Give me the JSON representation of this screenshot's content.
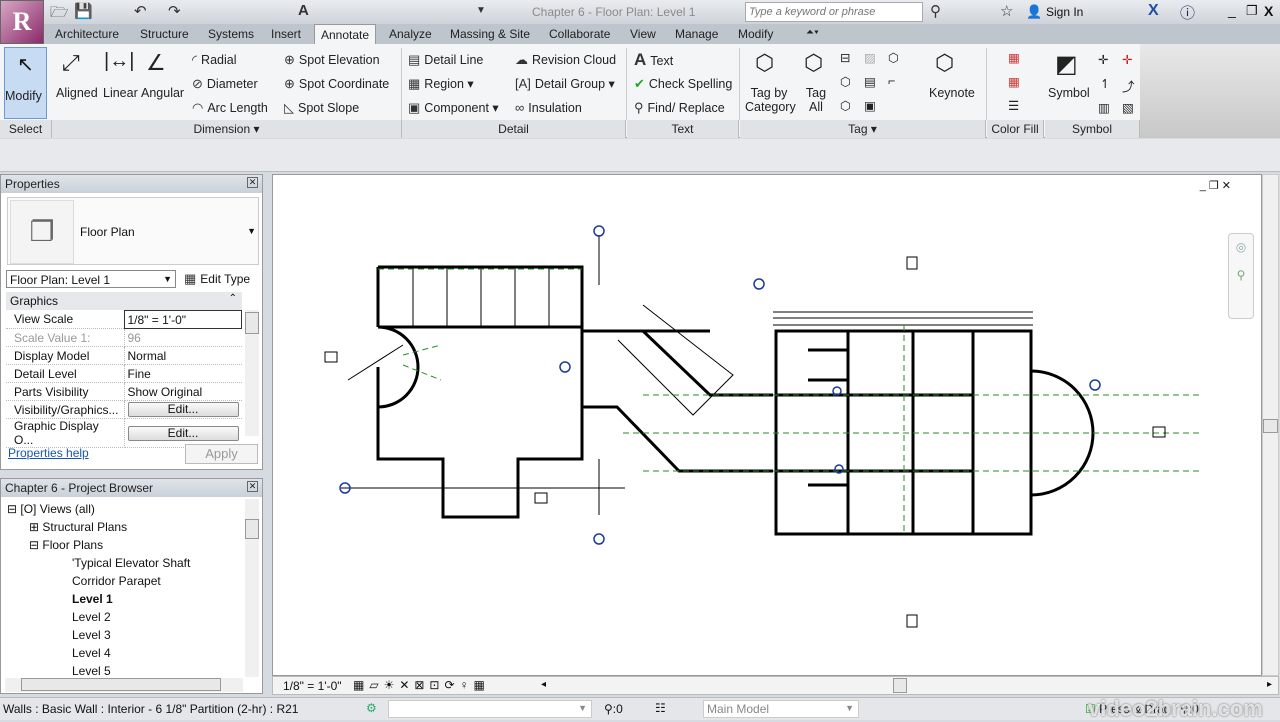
{
  "app": {
    "logo": "R",
    "title": "Chapter 6 - Floor Plan: Level 1",
    "search_placeholder": "Type a keyword or phrase",
    "sign_in": "Sign In"
  },
  "tabs": [
    "Architecture",
    "Structure",
    "Systems",
    "Insert",
    "Annotate",
    "Analyze",
    "Massing & Site",
    "Collaborate",
    "View",
    "Manage",
    "Modify"
  ],
  "ribbon": {
    "select": {
      "modify": "Modify",
      "label": "Select"
    },
    "dimension": {
      "aligned": "Aligned",
      "linear": "Linear",
      "angular": "Angular",
      "radial": "Radial",
      "diameter": "Diameter",
      "arc_length": "Arc  Length",
      "spot_elevation": "Spot  Elevation",
      "spot_coordinate": "Spot  Coordinate",
      "spot_slope": "Spot  Slope",
      "label": "Dimension ▾"
    },
    "detail": {
      "detail_line": "Detail  Line",
      "region": "Region  ▾",
      "component": "Component  ▾",
      "revision_cloud": "Revision  Cloud",
      "detail_group": "Detail  Group  ▾",
      "insulation": "Insulation",
      "label": "Detail"
    },
    "text": {
      "text": "Text",
      "check_spelling": "Check Spelling",
      "find_replace": "Find/  Replace",
      "label": "Text"
    },
    "tag": {
      "tag_by_category": "Tag by Category",
      "tag_all": "Tag All",
      "keynote": "Keynote",
      "label": "Tag ▾"
    },
    "color_fill": {
      "label": "Color Fill"
    },
    "symbol": {
      "symbol": "Symbol",
      "label": "Symbol"
    }
  },
  "properties": {
    "title": "Properties",
    "type_name": "Floor Plan",
    "instance_selector": "Floor Plan: Level 1",
    "edit_type": "Edit Type",
    "group": "Graphics",
    "rows": [
      {
        "k": "View Scale",
        "v": "1/8\" = 1'-0\""
      },
      {
        "k": "Scale Value    1:",
        "v": "96"
      },
      {
        "k": "Display Model",
        "v": "Normal"
      },
      {
        "k": "Detail Level",
        "v": "Fine"
      },
      {
        "k": "Parts Visibility",
        "v": "Show Original"
      },
      {
        "k": "Visibility/Graphics...",
        "v": "Edit..."
      },
      {
        "k": "Graphic Display O...",
        "v": "Edit..."
      }
    ],
    "help": "Properties help",
    "apply": "Apply"
  },
  "browser": {
    "title": "Chapter 6 - Project Browser",
    "items": [
      "Views (all)",
      "Structural Plans",
      "Floor Plans",
      "'Typical Elevator Shaft",
      "Corridor Parapet",
      "Level 1",
      "Level 2",
      "Level 3",
      "Level 4",
      "Level 5"
    ]
  },
  "viewbar": {
    "scale": "1/8\" = 1'-0\""
  },
  "status": {
    "text": "Walls : Basic Wall : Interior - 6 1/8\" Partition (2-hr) : R21",
    "worksets": ":0",
    "model": "Main Model",
    "press_drag": "Press & Drag",
    "filter": ":0",
    "watermark": "video2brain.com"
  }
}
